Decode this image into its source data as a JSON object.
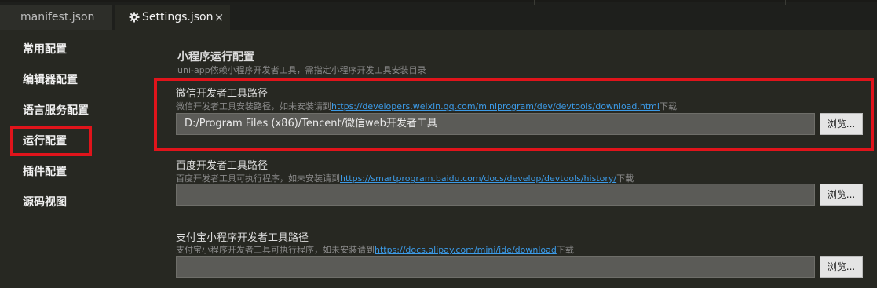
{
  "tabs": [
    {
      "label": "manifest.json",
      "active": false
    },
    {
      "label": "Settings.json",
      "active": true,
      "icon": "gear-icon",
      "close": "×"
    }
  ],
  "sidebar": {
    "items": [
      {
        "label": "常用配置"
      },
      {
        "label": "编辑器配置"
      },
      {
        "label": "语言服务配置"
      },
      {
        "label": "运行配置",
        "selected": true
      },
      {
        "label": "插件配置"
      },
      {
        "label": "源码视图"
      }
    ]
  },
  "section": {
    "title": "小程序运行配置",
    "description": "uni-app依赖小程序开发者工具，需指定小程序开发工具安装目录"
  },
  "fields": [
    {
      "label": "微信开发者工具路径",
      "desc_prefix": "微信开发者工具安装路径，如未安装请到",
      "link": "https://developers.weixin.qq.com/miniprogram/dev/devtools/download.html",
      "desc_suffix": "下载",
      "value": "D:/Program Files (x86)/Tencent/微信web开发者工具",
      "button": "浏览..."
    },
    {
      "label": "百度开发者工具路径",
      "desc_prefix": "百度开发者工具可执行程序，如未安装请到",
      "link": "https://smartprogram.baidu.com/docs/develop/devtools/history/",
      "desc_suffix": "下载",
      "value": "",
      "button": "浏览..."
    },
    {
      "label": "支付宝小程序开发者工具路径",
      "desc_prefix": "支付宝小程序开发者工具可执行程序，如未安装请到",
      "link": "https://docs.alipay.com/mini/ide/download",
      "desc_suffix": "下载",
      "value": "",
      "button": "浏览..."
    }
  ],
  "colors": {
    "background": "#272822",
    "highlight": "#e0141b",
    "link": "#3c9be8"
  }
}
